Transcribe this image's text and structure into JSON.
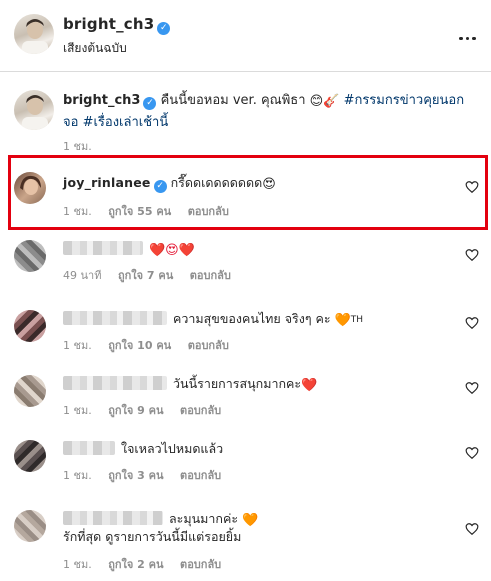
{
  "header": {
    "username": "bright_ch3",
    "subtitle": "เสียงต้นฉบับ"
  },
  "caption": {
    "username": "bright_ch3",
    "text": "คืนนี้ขอหอม ver. คุณพิธา",
    "emojis": "😊🎸",
    "tag1": "#กรรมกรข่าวคุยนอก",
    "tag1_cont": "จอ",
    "tag2": "#เรื่องเล่าเช้านี้",
    "time": "1 ชม."
  },
  "comments": [
    {
      "username": "joy_rinlanee",
      "text": "กรี๊ดดเดดดดดดด",
      "emoji": "😍",
      "time": "1 ชม.",
      "likes": "ถูกใจ 55 คน",
      "reply": "ตอบกลับ",
      "highlighted": true
    },
    {
      "text": "",
      "emoji": "❤️😍❤️",
      "time": "49 นาที",
      "likes": "ถูกใจ 7 คน",
      "reply": "ตอบกลับ"
    },
    {
      "text": "ความสุขของคนไทย จริงๆ คะ",
      "emoji": "🧡",
      "suffix": "TH",
      "time": "1 ชม.",
      "likes": "ถูกใจ 10 คน",
      "reply": "ตอบกลับ"
    },
    {
      "text": "วันนี้รายการสนุกมากคะ",
      "emoji": "❤️",
      "time": "1 ชม.",
      "likes": "ถูกใจ 9 คน",
      "reply": "ตอบกลับ"
    },
    {
      "text": "ใจเหลวไปหมดแล้ว",
      "emoji": "",
      "time": "1 ชม.",
      "likes": "ถูกใจ 3 คน",
      "reply": "ตอบกลับ"
    },
    {
      "text": "ละมุนมากค่ะ",
      "emoji": "🧡",
      "text2": "รักที่สุด ดูรายการวันนี้มีแต่รอยยิ้ม",
      "time": "1 ชม.",
      "likes": "ถูกใจ 2 คน",
      "reply": "ตอบกลับ"
    }
  ],
  "colors": {
    "highlight_border": "#e3000f",
    "verified": "#3897f0",
    "hashtag": "#00376b",
    "meta_text": "#8e8e8e"
  },
  "icons": {
    "more": "more-options-icon",
    "verified": "verified-badge-icon",
    "like": "heart-outline-icon"
  }
}
